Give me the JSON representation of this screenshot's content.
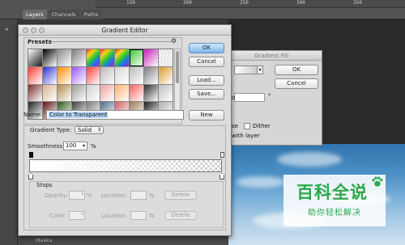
{
  "panel_tabs": [
    "Layers",
    "Channels",
    "Paths"
  ],
  "ruler_marks": [
    "150",
    "200",
    "250",
    "300",
    "350"
  ],
  "bottom_panel": "Masks",
  "gradient_fill": {
    "title": "Gradient Fill",
    "ok": "OK",
    "cancel": "Cancel",
    "angle_unit": "°",
    "scale_unit": "%",
    "reverse_partial": "se",
    "dither": "Dither",
    "align_partial": "with layer",
    "o_label": "o"
  },
  "editor": {
    "title": "Gradient Editor",
    "presets_label": "Presets",
    "buttons": {
      "ok": "OK",
      "cancel": "Cancel",
      "load": "Load...",
      "save": "Save...",
      "new": "New"
    },
    "name_label": "Name:",
    "name_value": "Color to Transparent",
    "gradient_type_label": "Gradient Type:",
    "gradient_type_value": "Solid",
    "smoothness_label": "Smoothness:",
    "smoothness_value": "100",
    "smoothness_unit": "%",
    "stops": {
      "label": "Stops",
      "opacity_label": "Opacity:",
      "opacity_unit": "%",
      "color_label": "Color:",
      "location_label": "Location:",
      "location_unit": "%",
      "delete_label": "Delete"
    }
  },
  "preset_colors": [
    [
      "#ffffff",
      "#000000",
      "#8a8a8a",
      "#7a7a7a",
      "#ff2a2a",
      "#1e6bff",
      "#ffd21a",
      "#30c82e",
      "#c61fb8",
      "#ffffff"
    ],
    [
      "#ff3b2f",
      "#2f2fd6",
      "#ff8a00",
      "#9c56ff",
      "#ff3d3d",
      "#b7b7b7",
      "#d7d7d7",
      "#bcbcbc",
      "#7c7c7c",
      "#d89a2e"
    ],
    [
      "#7a2e2e",
      "#d6b48e",
      "#b48a4b",
      "#9a9a9a",
      "#cfcfcf",
      "#f0a0a0",
      "#ffb070",
      "#ff6060",
      "#2c2c2c",
      "#bdbdbd"
    ],
    [
      "#202020",
      "#5c0f0f",
      "#2a5a1a",
      "#3a3a3a",
      "#7a7a7a",
      "#4a6a8a",
      "#d26060",
      "#9a7a5a",
      "#1a1a1a",
      "#b0b0b0"
    ]
  ],
  "watermark": {
    "title": "百科全说",
    "subtitle": "助你轻松解决"
  }
}
